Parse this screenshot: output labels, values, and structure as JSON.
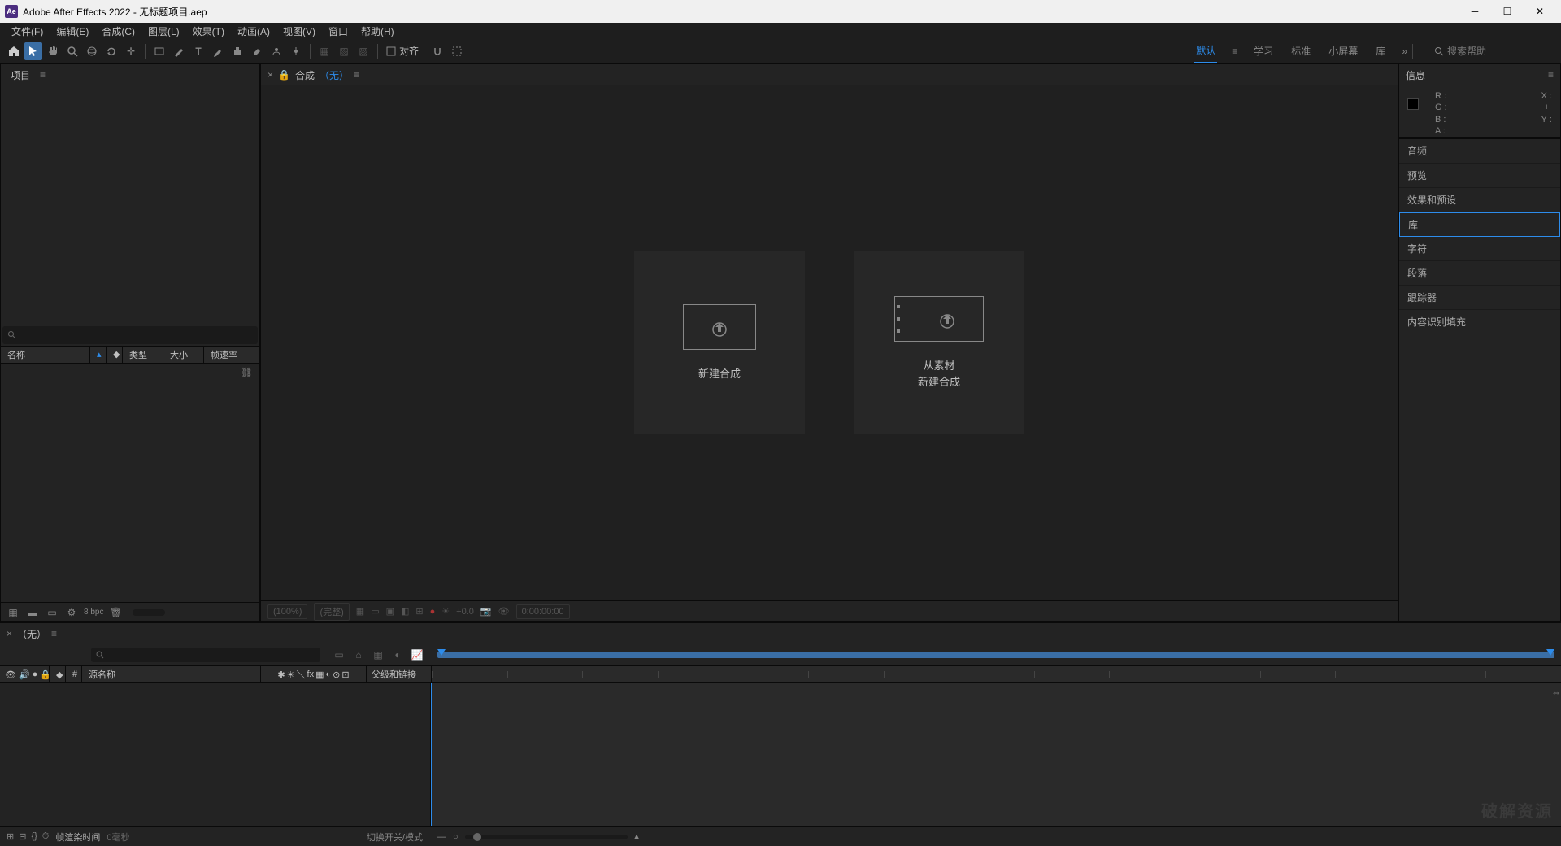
{
  "titlebar": {
    "app_icon_text": "Ae",
    "title": "Adobe After Effects 2022 - 无标题项目.aep"
  },
  "menubar": [
    "文件(F)",
    "编辑(E)",
    "合成(C)",
    "图层(L)",
    "效果(T)",
    "动画(A)",
    "视图(V)",
    "窗口",
    "帮助(H)"
  ],
  "toolbar": {
    "snap_label": "对齐",
    "search_placeholder": "搜索帮助"
  },
  "workspaces": {
    "items": [
      "默认",
      "学习",
      "标准",
      "小屏幕",
      "库"
    ],
    "active_index": 0
  },
  "project_panel": {
    "title": "项目",
    "columns": [
      "名称",
      "类型",
      "大小",
      "帧速率"
    ],
    "bpc": "8 bpc"
  },
  "comp_panel": {
    "tab_prefix": "合成",
    "tab_none": "（无）",
    "card_new": "新建合成",
    "card_from_footage_l1": "从素材",
    "card_from_footage_l2": "新建合成",
    "footer_zoom": "(100%)",
    "footer_res": "(完整)",
    "footer_exposure": "+0.0",
    "footer_time": "0:00:00:00"
  },
  "info_panel": {
    "title": "信息",
    "R": "R :",
    "G": "G :",
    "B": "B :",
    "A": "A :",
    "X": "X :",
    "Y": "Y :"
  },
  "side_panels": [
    "音频",
    "预览",
    "效果和预设",
    "库",
    "字符",
    "段落",
    "跟踪器",
    "内容识别填充"
  ],
  "side_selected_index": 3,
  "timeline": {
    "tab_none": "（无）",
    "col_source": "源名称",
    "col_parent": "父级和链接",
    "render_label": "帧渲染时间",
    "render_time": "0毫秒",
    "switch_label": "切换开关/模式"
  },
  "watermark": "破解资源"
}
